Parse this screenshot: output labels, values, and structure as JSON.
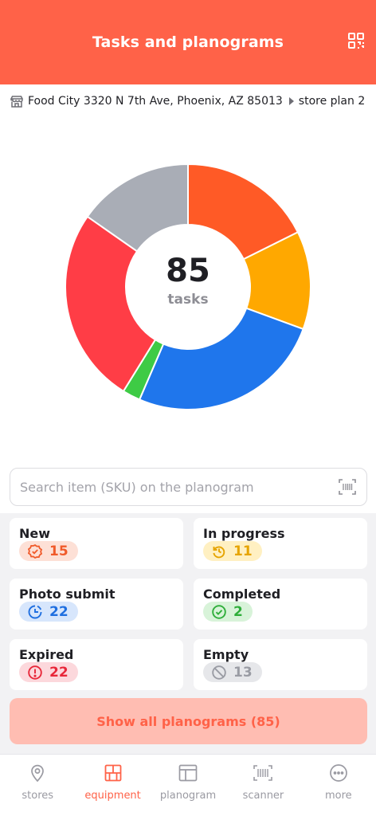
{
  "header": {
    "title": "Tasks and planograms",
    "qr_icon": "qr-code-icon"
  },
  "store": {
    "address": "Food City 3320 N 7th Ave, Phoenix, AZ 85013",
    "plan": "store plan 2",
    "store_icon": "storefront-icon",
    "separator_icon": "triangle-right-icon"
  },
  "chart_data": {
    "type": "pie",
    "donut": true,
    "center_value": "85",
    "center_label": "tasks",
    "slices": [
      {
        "value": 15,
        "color": "#ff5a26"
      },
      {
        "value": 11,
        "color": "#ffa800"
      },
      {
        "value": 22,
        "color": "#1f76ec"
      },
      {
        "value": 2,
        "color": "#3ecb45"
      },
      {
        "value": 22,
        "color": "#ff3d46"
      },
      {
        "value": 13,
        "color": "#a9adb6"
      }
    ]
  },
  "search": {
    "placeholder": "Search item (SKU) on the planogram",
    "icon": "barcode-scan-icon"
  },
  "status_cards": [
    {
      "title": "New",
      "count": "15",
      "icon": "badge-check-icon",
      "color": "#f05a2a",
      "bg": "#fde0d6"
    },
    {
      "title": "In progress",
      "count": "11",
      "icon": "rotate-icon",
      "color": "#e6a400",
      "bg": "#fff0c2"
    },
    {
      "title": "Photo submit",
      "count": "22",
      "icon": "clock-pie-icon",
      "color": "#1f6fe0",
      "bg": "#d7e6fc"
    },
    {
      "title": "Completed",
      "count": "2",
      "icon": "check-circle-icon",
      "color": "#2fae3a",
      "bg": "#d8f3d9"
    },
    {
      "title": "Expired",
      "count": "22",
      "icon": "alert-circle-icon",
      "color": "#e8283a",
      "bg": "#fcd8dc"
    },
    {
      "title": "Empty",
      "count": "13",
      "icon": "block-icon",
      "color": "#9a9ca4",
      "bg": "#e6e7ea"
    }
  ],
  "show_all": {
    "label": "Show all planograms (85)"
  },
  "nav": {
    "items": [
      {
        "label": "stores",
        "icon": "location-pin-icon"
      },
      {
        "label": "equipment",
        "icon": "shelves-icon",
        "active": true
      },
      {
        "label": "planogram",
        "icon": "layout-icon"
      },
      {
        "label": "scanner",
        "icon": "barcode-icon"
      },
      {
        "label": "more",
        "icon": "more-dots-icon"
      }
    ]
  },
  "colors": {
    "accent": "#ff6248",
    "accent_soft": "#ffbdb2"
  }
}
